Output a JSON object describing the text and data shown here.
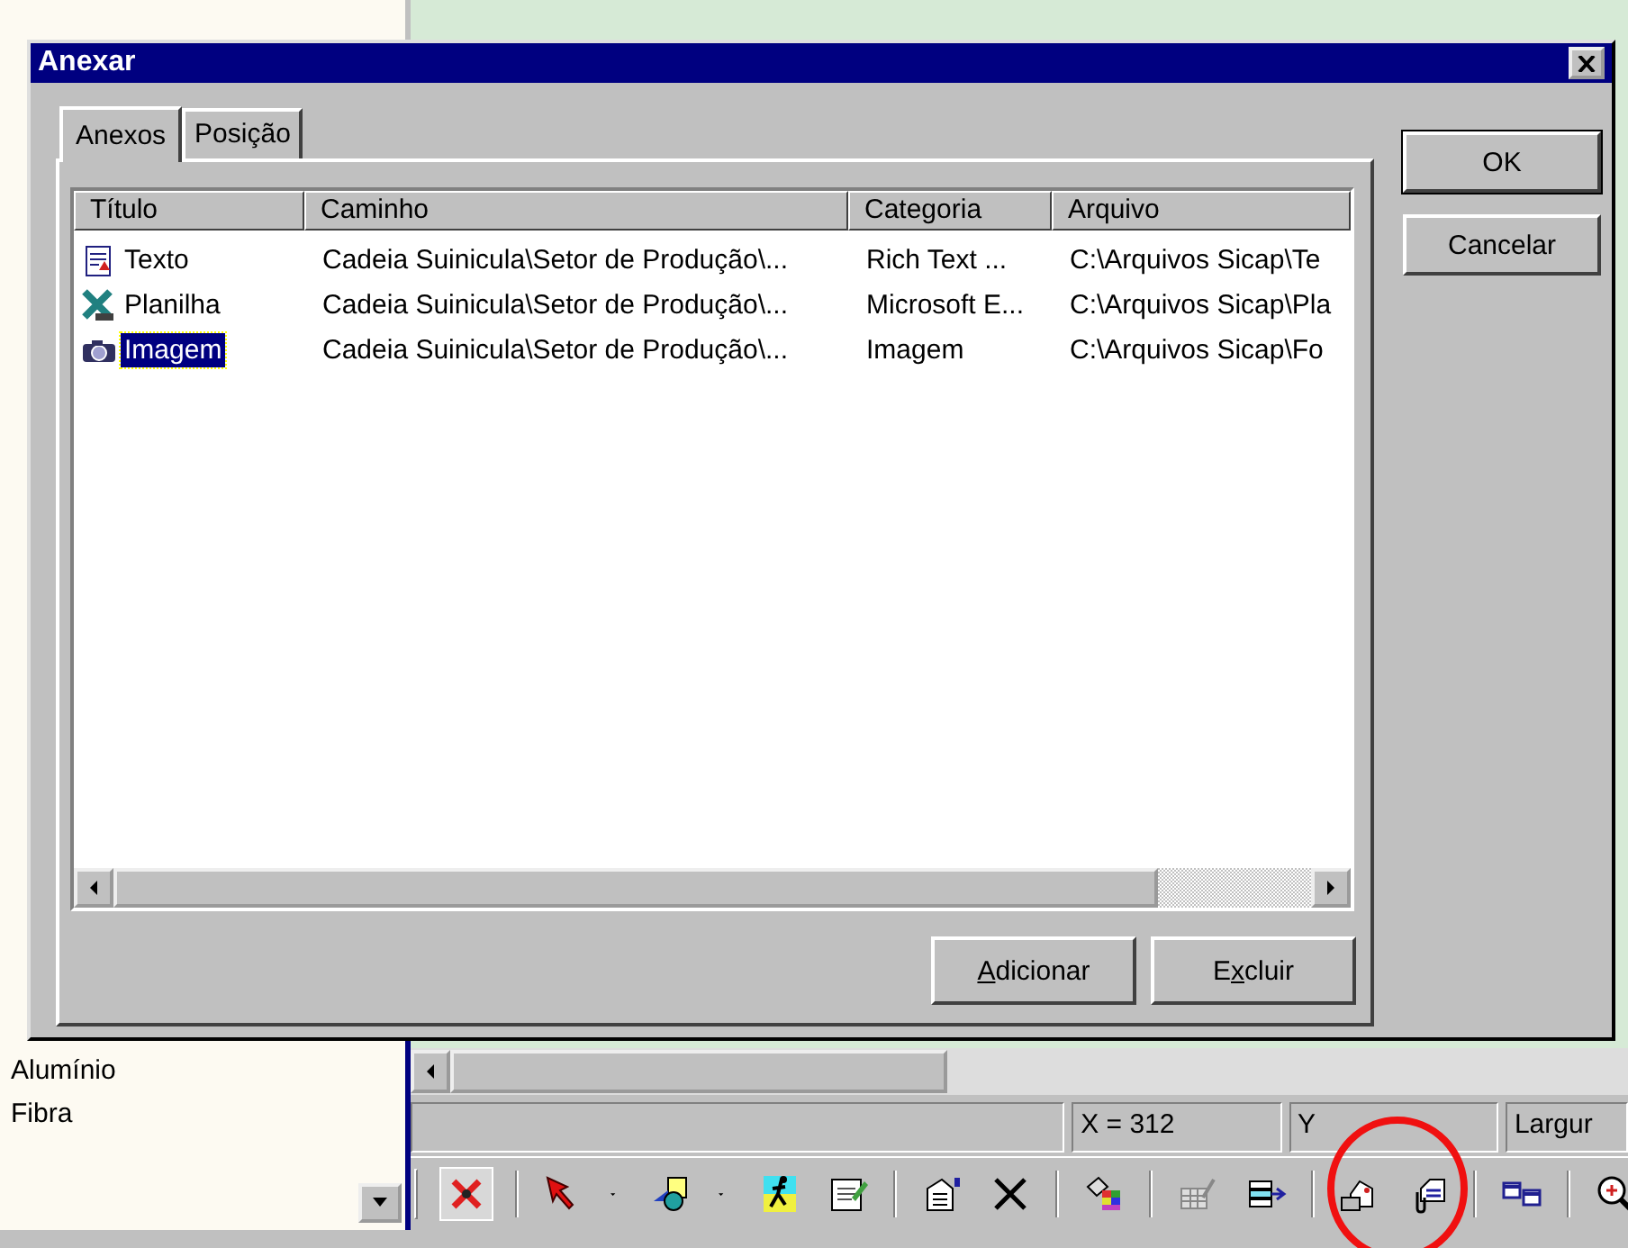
{
  "side_list": [
    "Alumínio",
    "Fibra"
  ],
  "status_bar": {
    "fields": [
      "X = 312",
      "Y",
      "Largur"
    ]
  },
  "dialog": {
    "title": "Anexar",
    "tabs": [
      {
        "label": "Anexos",
        "selected": true
      },
      {
        "label": "Posição",
        "selected": false
      }
    ],
    "table": {
      "columns": [
        "Título",
        "Caminho",
        "Categoria",
        "Arquivo"
      ],
      "rows": [
        {
          "kind": "text",
          "selected": false,
          "cells": [
            "Texto",
            "Cadeia Suinicula\\Setor de Produção\\...",
            "Rich Text ...",
            "C:\\Arquivos Sicap\\Te"
          ]
        },
        {
          "kind": "spreadsheet",
          "selected": false,
          "cells": [
            "Planilha",
            "Cadeia Suinicula\\Setor de Produção\\...",
            "Microsoft E...",
            "C:\\Arquivos Sicap\\Pla"
          ]
        },
        {
          "kind": "image",
          "selected": true,
          "cells": [
            "Imagem",
            "Cadeia Suinicula\\Setor de Produção\\...",
            "Imagem",
            "C:\\Arquivos Sicap\\Fo"
          ]
        }
      ]
    },
    "list_buttons": [
      {
        "label_parts": [
          {
            "text": "A",
            "underline": true
          },
          {
            "text": "dicionar",
            "underline": false
          }
        ]
      },
      {
        "label_parts": [
          {
            "text": "E",
            "underline": false
          },
          {
            "text": "x",
            "underline": true
          },
          {
            "text": "cluir",
            "underline": false
          }
        ]
      }
    ],
    "side_buttons": [
      {
        "label": "OK",
        "default": true
      },
      {
        "label": "Cancelar",
        "default": false
      }
    ]
  }
}
